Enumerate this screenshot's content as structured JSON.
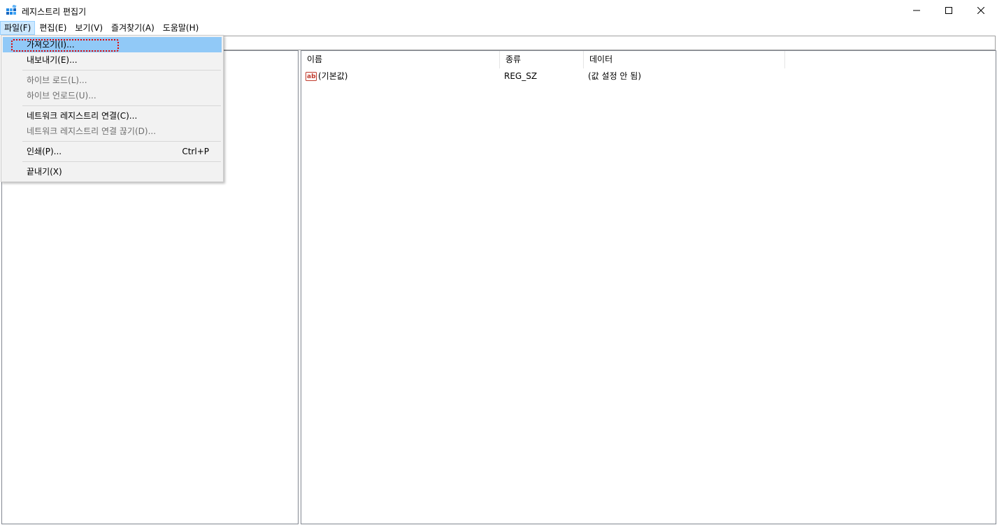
{
  "window": {
    "title": "레지스트리 편집기",
    "icon": "registry-editor-icon"
  },
  "controls": {
    "minimize_icon": "minimize-icon",
    "maximize_icon": "maximize-icon",
    "close_icon": "close-icon"
  },
  "menubar": {
    "items": [
      {
        "label": "파일(F)",
        "active": true
      },
      {
        "label": "편집(E)"
      },
      {
        "label": "보기(V)"
      },
      {
        "label": "즐겨찾기(A)"
      },
      {
        "label": "도움말(H)"
      }
    ]
  },
  "file_menu": {
    "items": [
      {
        "label": "가져오기(I)...",
        "enabled": true,
        "highlighted": true
      },
      {
        "label": "내보내기(E)...",
        "enabled": true
      },
      {
        "label": "하이브 로드(L)...",
        "enabled": false
      },
      {
        "label": "하이브 언로드(U)...",
        "enabled": false
      },
      {
        "label": "네트워크 레지스트리 연결(C)...",
        "enabled": true
      },
      {
        "label": "네트워크 레지스트리 연결 끊기(D)...",
        "enabled": false
      },
      {
        "label": "인쇄(P)...",
        "shortcut": "Ctrl+P",
        "enabled": true
      },
      {
        "label": "끝내기(X)",
        "enabled": true
      }
    ]
  },
  "list": {
    "columns": {
      "name": "이름",
      "type": "종류",
      "data": "데이터"
    },
    "rows": [
      {
        "name": "(기본값)",
        "type": "REG_SZ",
        "data": "(값 설정 안 됨)",
        "icon": "string-value-icon"
      }
    ]
  },
  "colors": {
    "menu_highlight": "#91c9f7",
    "menubar_active": "#cce8ff",
    "annotation": "#e00000"
  }
}
